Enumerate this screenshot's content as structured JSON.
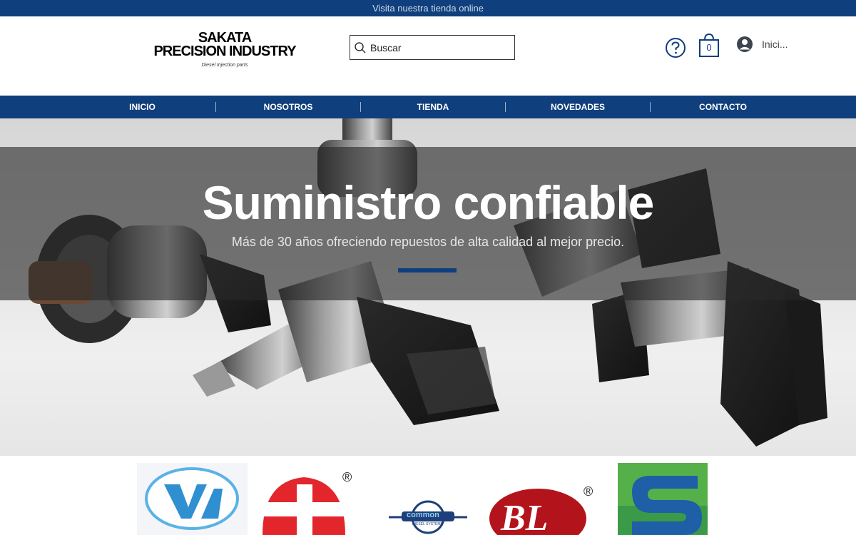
{
  "topbar": {
    "text": "Visita nuestra tienda online"
  },
  "logo": {
    "line1": "SAKATA",
    "line2": "PRECISION INDUSTRY",
    "tagline": "Diesel Injection parts"
  },
  "search": {
    "placeholder": "Buscar"
  },
  "icons": {
    "search": "search-icon",
    "help": "help-circle-icon",
    "cart": "shopping-bag-icon",
    "user": "user-avatar-icon"
  },
  "cart": {
    "count": "0"
  },
  "login": {
    "label": "Inici..."
  },
  "nav": {
    "items": [
      {
        "label": "INICIO"
      },
      {
        "label": "NOSOTROS"
      },
      {
        "label": "TIENDA"
      },
      {
        "label": "NOVEDADES"
      },
      {
        "label": "CONTACTO"
      }
    ]
  },
  "hero": {
    "title": "Suministro confiable",
    "subtitle": "Más de 30 años ofreciendo repuestos de alta calidad al mejor precio."
  },
  "brands": {
    "registered": "®",
    "common_text": "common",
    "common_sub": "DIESEL SYSTEMS",
    "bl_text": "BL"
  },
  "colors": {
    "brand_blue": "#0f3f7c",
    "hero_band": "#2828289e",
    "red": "#e3262b",
    "light_blue": "#5ab2e6"
  }
}
